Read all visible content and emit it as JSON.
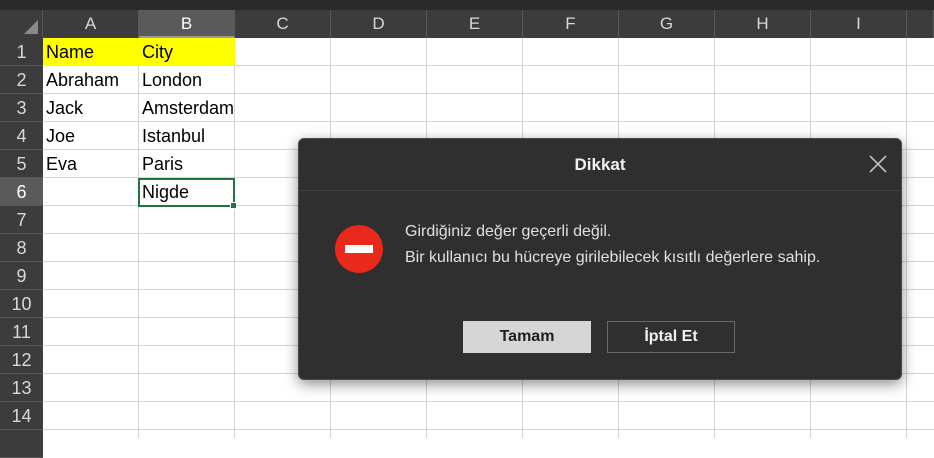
{
  "sheet": {
    "columns": [
      "A",
      "B",
      "C",
      "D",
      "E",
      "F",
      "G",
      "H",
      "I"
    ],
    "selected_column": "B",
    "rows": [
      "1",
      "2",
      "3",
      "4",
      "5",
      "6",
      "7",
      "8",
      "9",
      "10",
      "11",
      "12",
      "13",
      "14"
    ],
    "selected_row": "6",
    "cells": {
      "A1": "Name",
      "B1": "City",
      "A2": "Abraham",
      "B2": "London",
      "A3": "Jack",
      "B3": "Amsterdam",
      "A4": "Joe",
      "B4": "Istanbul",
      "A5": "Eva",
      "B5": "Paris",
      "B6": "Nigde"
    },
    "header_fill_color": "#ffff00",
    "active_cell_border_color": "#217346"
  },
  "dialog": {
    "title": "Dikkat",
    "close_icon": "close-icon",
    "status_icon": "stop-icon",
    "status_icon_color": "#e8291c",
    "message_line1": "Girdiğiniz değer geçerli değil.",
    "message_line2": "Bir kullanıcı bu hücreye girilebilecek kısıtlı değerlere sahip.",
    "ok_label": "Tamam",
    "cancel_label": "İptal Et"
  }
}
